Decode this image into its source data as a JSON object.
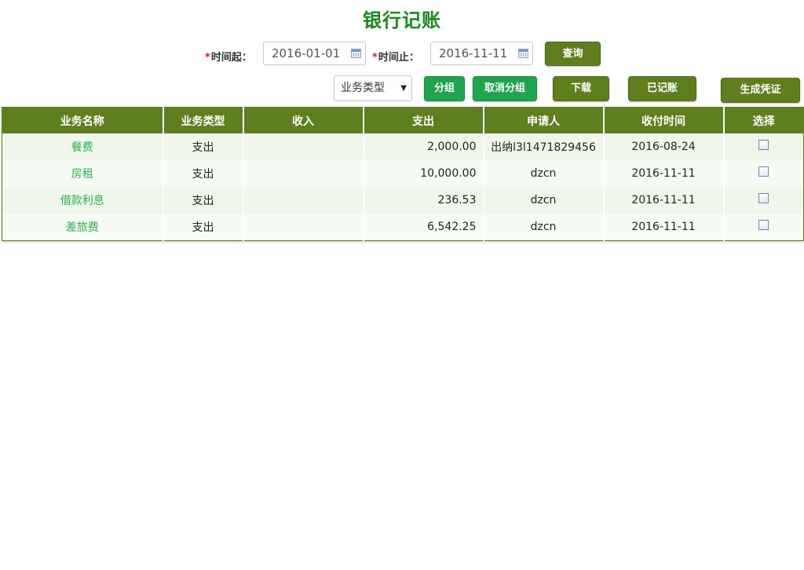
{
  "page": {
    "title": "银行记账"
  },
  "filters": {
    "required_mark": "*",
    "start_label": "时间起：",
    "start_value": "2016-01-01",
    "end_label": "时间止：",
    "end_value": "2016-11-11",
    "query_button": "查询"
  },
  "toolbar": {
    "type_select": "业务类型",
    "group_button": "分组",
    "ungroup_button": "取消分组",
    "download_button": "下载",
    "recorded_button": "已记账",
    "voucher_button": "生成凭证"
  },
  "table": {
    "headers": [
      "业务名称",
      "业务类型",
      "收入",
      "支出",
      "申请人",
      "收付时间",
      "选择"
    ],
    "rows": [
      {
        "name": "餐费",
        "type": "支出",
        "income": "",
        "expense": "2,000.00",
        "applicant": "出纳l3l1471829456",
        "date": "2016-08-24",
        "selected": false
      },
      {
        "name": "房租",
        "type": "支出",
        "income": "",
        "expense": "10,000.00",
        "applicant": "dzcn",
        "date": "2016-11-11",
        "selected": false
      },
      {
        "name": "借款利息",
        "type": "支出",
        "income": "",
        "expense": "236.53",
        "applicant": "dzcn",
        "date": "2016-11-11",
        "selected": false
      },
      {
        "name": "差旅费",
        "type": "支出",
        "income": "",
        "expense": "6,542.25",
        "applicant": "dzcn",
        "date": "2016-11-11",
        "selected": false
      }
    ]
  },
  "colors": {
    "title_green": "#1a8a1a",
    "header_olive": "#5f7f1f",
    "button_green": "#20a450",
    "name_link_green": "#2db34a",
    "required_red": "#e02020"
  },
  "icons": {
    "date_picker": "calendar-icon",
    "select_arrow": "dropdown-arrow-icon",
    "row_select": "checkbox"
  }
}
